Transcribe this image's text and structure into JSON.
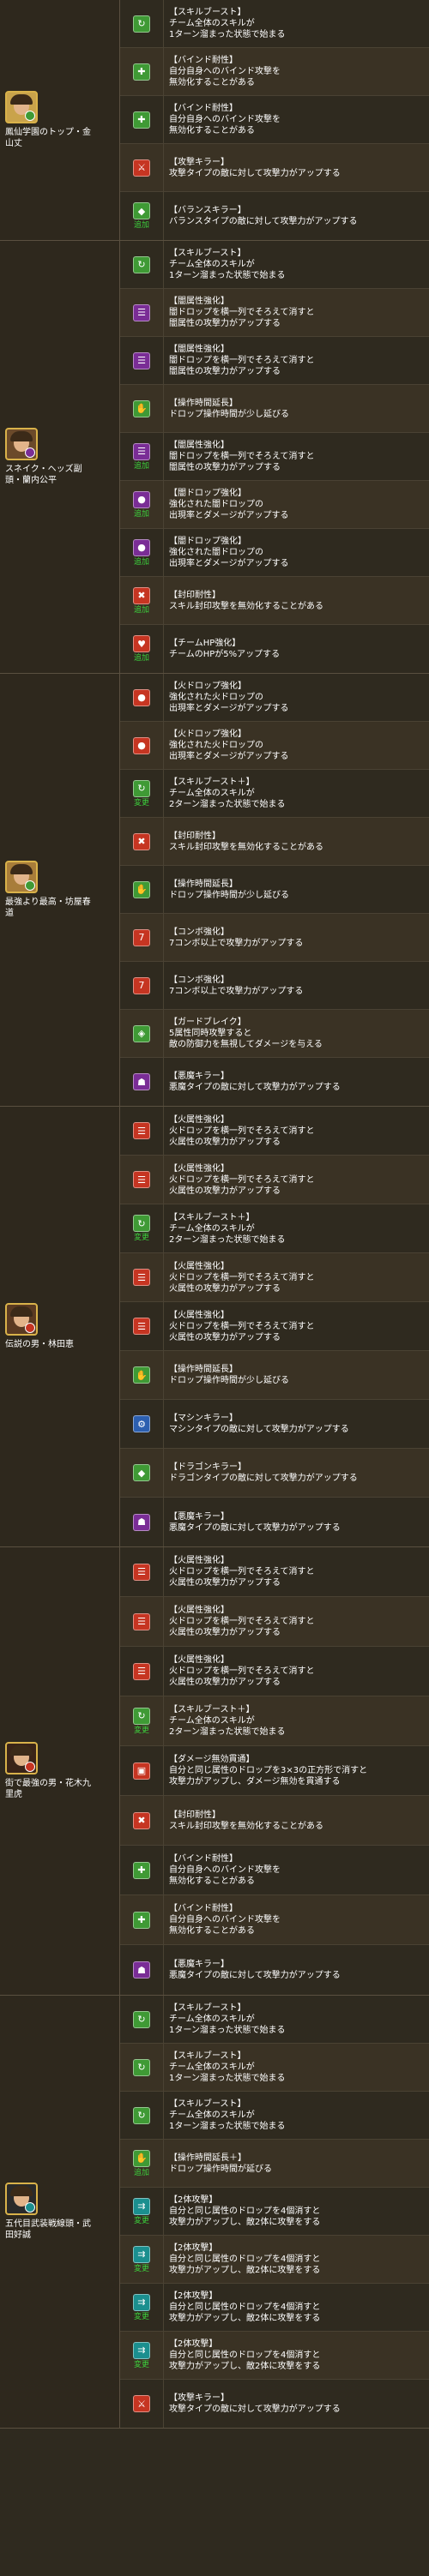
{
  "colors": {
    "background": "#2f2a1f",
    "row_highlight": "#3a3224",
    "tag_green": "#3ccf3c",
    "icon_green": "#3f9a35",
    "icon_red": "#c63522",
    "icon_purple": "#7a2d96",
    "icon_teal": "#1b8f8f",
    "icon_blue": "#2c5fb0"
  },
  "groups": [
    {
      "name": "鳳仙学園のトップ・金\n山丈",
      "portrait_color": "#c9a34b",
      "orb_color": "#3f9a35",
      "skills": [
        {
          "icon": "skill-boost-icon",
          "color": "#3f9a35",
          "glyph": "↻",
          "tag": "",
          "title": "【スキルブースト】",
          "desc": "チーム全体のスキルが\n1ターン溜まった状態で始まる"
        },
        {
          "icon": "bind-resist-icon",
          "color": "#3f9a35",
          "glyph": "✚",
          "tag": "",
          "title": "【バインド耐性】",
          "desc": "自分自身へのバインド攻撃を\n無効化することがある"
        },
        {
          "icon": "bind-resist-icon",
          "color": "#3f9a35",
          "glyph": "✚",
          "tag": "",
          "title": "【バインド耐性】",
          "desc": "自分自身へのバインド攻撃を\n無効化することがある"
        },
        {
          "icon": "attacker-killer-icon",
          "color": "#c63522",
          "glyph": "⚔",
          "tag": "",
          "title": "【攻撃キラー】",
          "desc": "攻撃タイプの敵に対して攻撃力がアップする"
        },
        {
          "icon": "balance-killer-icon",
          "color": "#3f9a35",
          "glyph": "◆",
          "tag": "追加",
          "title": "【バランスキラー】",
          "desc": "バランスタイプの敵に対して攻撃力がアップする"
        }
      ]
    },
    {
      "name": "スネイク・ヘッズ副\n頭・蘭内公平",
      "portrait_color": "#6b4a2a",
      "orb_color": "#7a2d96",
      "skills": [
        {
          "icon": "skill-boost-icon",
          "color": "#3f9a35",
          "glyph": "↻",
          "tag": "",
          "title": "【スキルブースト】",
          "desc": "チーム全体のスキルが\n1ターン溜まった状態で始まる"
        },
        {
          "icon": "dark-row-icon",
          "color": "#7a2d96",
          "glyph": "☰",
          "tag": "",
          "title": "【闇属性強化】",
          "desc": "闇ドロップを横一列でそろえて消すと\n闇属性の攻撃力がアップする"
        },
        {
          "icon": "dark-row-icon",
          "color": "#7a2d96",
          "glyph": "☰",
          "tag": "",
          "title": "【闇属性強化】",
          "desc": "闇ドロップを横一列でそろえて消すと\n闇属性の攻撃力がアップする"
        },
        {
          "icon": "extend-time-icon",
          "color": "#3f9a35",
          "glyph": "✋",
          "tag": "",
          "title": "【操作時間延長】",
          "desc": "ドロップ操作時間が少し延びる"
        },
        {
          "icon": "dark-row-icon",
          "color": "#7a2d96",
          "glyph": "☰",
          "tag": "追加",
          "title": "【闇属性強化】",
          "desc": "闇ドロップを横一列でそろえて消すと\n闇属性の攻撃力がアップする"
        },
        {
          "icon": "dark-orb-enhance-icon",
          "color": "#7a2d96",
          "glyph": "●",
          "tag": "追加",
          "title": "【闇ドロップ強化】",
          "desc": "強化された闇ドロップの\n出現率とダメージがアップする"
        },
        {
          "icon": "dark-orb-enhance-icon",
          "color": "#7a2d96",
          "glyph": "●",
          "tag": "追加",
          "title": "【闇ドロップ強化】",
          "desc": "強化された闇ドロップの\n出現率とダメージがアップする"
        },
        {
          "icon": "seal-resist-icon",
          "color": "#c63522",
          "glyph": "✖",
          "tag": "追加",
          "title": "【封印耐性】",
          "desc": "スキル封印攻撃を無効化することがある"
        },
        {
          "icon": "team-hp-icon",
          "color": "#c63522",
          "glyph": "♥",
          "tag": "追加",
          "title": "【チームHP強化】",
          "desc": "チームのHPが5%アップする"
        }
      ]
    },
    {
      "name": "最強より最高・坊屋春\n道",
      "portrait_color": "#a87d3a",
      "orb_color": "#3f9a35",
      "skills": [
        {
          "icon": "fire-orb-enhance-icon",
          "color": "#c63522",
          "glyph": "●",
          "tag": "",
          "title": "【火ドロップ強化】",
          "desc": "強化された火ドロップの\n出現率とダメージがアップする"
        },
        {
          "icon": "fire-orb-enhance-icon",
          "color": "#c63522",
          "glyph": "●",
          "tag": "",
          "title": "【火ドロップ強化】",
          "desc": "強化された火ドロップの\n出現率とダメージがアップする"
        },
        {
          "icon": "skill-boost-plus-icon",
          "color": "#3f9a35",
          "glyph": "↻",
          "tag": "変更",
          "title": "【スキルブースト＋】",
          "desc": "チーム全体のスキルが\n2ターン溜まった状態で始まる"
        },
        {
          "icon": "seal-resist-icon",
          "color": "#c63522",
          "glyph": "✖",
          "tag": "",
          "title": "【封印耐性】",
          "desc": "スキル封印攻撃を無効化することがある"
        },
        {
          "icon": "extend-time-icon",
          "color": "#3f9a35",
          "glyph": "✋",
          "tag": "",
          "title": "【操作時間延長】",
          "desc": "ドロップ操作時間が少し延びる"
        },
        {
          "icon": "seven-combo-icon",
          "color": "#c63522",
          "glyph": "7",
          "tag": "",
          "title": "【コンボ強化】",
          "desc": "7コンボ以上で攻撃力がアップする"
        },
        {
          "icon": "seven-combo-icon",
          "color": "#c63522",
          "glyph": "7",
          "tag": "",
          "title": "【コンボ強化】",
          "desc": "7コンボ以上で攻撃力がアップする"
        },
        {
          "icon": "guard-break-icon",
          "color": "#3f9a35",
          "glyph": "◈",
          "tag": "",
          "title": "【ガードブレイク】",
          "desc": "5属性同時攻撃すると\n敵の防御力を無視してダメージを与える"
        },
        {
          "icon": "devil-killer-icon",
          "color": "#7a2d96",
          "glyph": "☗",
          "tag": "",
          "title": "【悪魔キラー】",
          "desc": "悪魔タイプの敵に対して攻撃力がアップする"
        }
      ]
    },
    {
      "name": "伝説の男・林田恵",
      "portrait_color": "#5a3a22",
      "orb_color": "#c63522",
      "skills": [
        {
          "icon": "fire-row-icon",
          "color": "#c63522",
          "glyph": "☰",
          "tag": "",
          "title": "【火属性強化】",
          "desc": "火ドロップを横一列でそろえて消すと\n火属性の攻撃力がアップする"
        },
        {
          "icon": "fire-row-icon",
          "color": "#c63522",
          "glyph": "☰",
          "tag": "",
          "title": "【火属性強化】",
          "desc": "火ドロップを横一列でそろえて消すと\n火属性の攻撃力がアップする"
        },
        {
          "icon": "skill-boost-plus-icon",
          "color": "#3f9a35",
          "glyph": "↻",
          "tag": "変更",
          "title": "【スキルブースト＋】",
          "desc": "チーム全体のスキルが\n2ターン溜まった状態で始まる"
        },
        {
          "icon": "fire-row-icon",
          "color": "#c63522",
          "glyph": "☰",
          "tag": "",
          "title": "【火属性強化】",
          "desc": "火ドロップを横一列でそろえて消すと\n火属性の攻撃力がアップする"
        },
        {
          "icon": "fire-row-icon",
          "color": "#c63522",
          "glyph": "☰",
          "tag": "",
          "title": "【火属性強化】",
          "desc": "火ドロップを横一列でそろえて消すと\n火属性の攻撃力がアップする"
        },
        {
          "icon": "extend-time-icon",
          "color": "#3f9a35",
          "glyph": "✋",
          "tag": "",
          "title": "【操作時間延長】",
          "desc": "ドロップ操作時間が少し延びる"
        },
        {
          "icon": "machine-killer-icon",
          "color": "#2c5fb0",
          "glyph": "⚙",
          "tag": "",
          "title": "【マシンキラー】",
          "desc": "マシンタイプの敵に対して攻撃力がアップする"
        },
        {
          "icon": "dragon-killer-icon",
          "color": "#3f9a35",
          "glyph": "◆",
          "tag": "",
          "title": "【ドラゴンキラー】",
          "desc": "ドラゴンタイプの敵に対して攻撃力がアップする"
        },
        {
          "icon": "devil-killer-icon",
          "color": "#7a2d96",
          "glyph": "☗",
          "tag": "",
          "title": "【悪魔キラー】",
          "desc": "悪魔タイプの敵に対して攻撃力がアップする"
        }
      ]
    },
    {
      "name": "街で最強の男・花木九\n里虎",
      "portrait_color": "#3a2418",
      "orb_color": "#c63522",
      "skills": [
        {
          "icon": "fire-row-icon",
          "color": "#c63522",
          "glyph": "☰",
          "tag": "",
          "title": "【火属性強化】",
          "desc": "火ドロップを横一列でそろえて消すと\n火属性の攻撃力がアップする"
        },
        {
          "icon": "fire-row-icon",
          "color": "#c63522",
          "glyph": "☰",
          "tag": "",
          "title": "【火属性強化】",
          "desc": "火ドロップを横一列でそろえて消すと\n火属性の攻撃力がアップする"
        },
        {
          "icon": "fire-row-icon",
          "color": "#c63522",
          "glyph": "☰",
          "tag": "",
          "title": "【火属性強化】",
          "desc": "火ドロップを横一列でそろえて消すと\n火属性の攻撃力がアップする"
        },
        {
          "icon": "skill-boost-plus-icon",
          "color": "#3f9a35",
          "glyph": "↻",
          "tag": "変更",
          "title": "【スキルブースト＋】",
          "desc": "チーム全体のスキルが\n2ターン溜まった状態で始まる"
        },
        {
          "icon": "damage-penetration-icon",
          "color": "#c63522",
          "glyph": "▣",
          "tag": "",
          "title": "【ダメージ無効貫通】",
          "desc": "自分と同じ属性のドロップを3×3の正方形で消すと\n攻撃力がアップし、ダメージ無効を貫通する"
        },
        {
          "icon": "seal-resist-icon",
          "color": "#c63522",
          "glyph": "✖",
          "tag": "",
          "title": "【封印耐性】",
          "desc": "スキル封印攻撃を無効化することがある"
        },
        {
          "icon": "bind-resist-icon",
          "color": "#3f9a35",
          "glyph": "✚",
          "tag": "",
          "title": "【バインド耐性】",
          "desc": "自分自身へのバインド攻撃を\n無効化することがある"
        },
        {
          "icon": "bind-resist-icon",
          "color": "#3f9a35",
          "glyph": "✚",
          "tag": "",
          "title": "【バインド耐性】",
          "desc": "自分自身へのバインド攻撃を\n無効化することがある"
        },
        {
          "icon": "devil-killer-icon",
          "color": "#7a2d96",
          "glyph": "☗",
          "tag": "",
          "title": "【悪魔キラー】",
          "desc": "悪魔タイプの敵に対して攻撃力がアップする"
        }
      ]
    },
    {
      "name": "五代目武装戦線頭・武\n田好誠",
      "portrait_color": "#2a2a2a",
      "orb_color": "#1b8f8f",
      "skills": [
        {
          "icon": "skill-boost-icon",
          "color": "#3f9a35",
          "glyph": "↻",
          "tag": "",
          "title": "【スキルブースト】",
          "desc": "チーム全体のスキルが\n1ターン溜まった状態で始まる"
        },
        {
          "icon": "skill-boost-icon",
          "color": "#3f9a35",
          "glyph": "↻",
          "tag": "",
          "title": "【スキルブースト】",
          "desc": "チーム全体のスキルが\n1ターン溜まった状態で始まる"
        },
        {
          "icon": "skill-boost-icon",
          "color": "#3f9a35",
          "glyph": "↻",
          "tag": "",
          "title": "【スキルブースト】",
          "desc": "チーム全体のスキルが\n1ターン溜まった状態で始まる"
        },
        {
          "icon": "extend-time-plus-icon",
          "color": "#3f9a35",
          "glyph": "✋",
          "tag": "追加",
          "title": "【操作時間延長＋】",
          "desc": "ドロップ操作時間が延びる"
        },
        {
          "icon": "two-way-icon",
          "color": "#1b8f8f",
          "glyph": "⇉",
          "tag": "変更",
          "title": "【2体攻撃】",
          "desc": "自分と同じ属性のドロップを4個消すと\n攻撃力がアップし、敵2体に攻撃をする"
        },
        {
          "icon": "two-way-icon",
          "color": "#1b8f8f",
          "glyph": "⇉",
          "tag": "変更",
          "title": "【2体攻撃】",
          "desc": "自分と同じ属性のドロップを4個消すと\n攻撃力がアップし、敵2体に攻撃をする"
        },
        {
          "icon": "two-way-icon",
          "color": "#1b8f8f",
          "glyph": "⇉",
          "tag": "変更",
          "title": "【2体攻撃】",
          "desc": "自分と同じ属性のドロップを4個消すと\n攻撃力がアップし、敵2体に攻撃をする"
        },
        {
          "icon": "two-way-icon",
          "color": "#1b8f8f",
          "glyph": "⇉",
          "tag": "変更",
          "title": "【2体攻撃】",
          "desc": "自分と同じ属性のドロップを4個消すと\n攻撃力がアップし、敵2体に攻撃をする"
        },
        {
          "icon": "attacker-killer-icon",
          "color": "#c63522",
          "glyph": "⚔",
          "tag": "",
          "title": "【攻撃キラー】",
          "desc": "攻撃タイプの敵に対して攻撃力がアップする"
        }
      ]
    }
  ]
}
